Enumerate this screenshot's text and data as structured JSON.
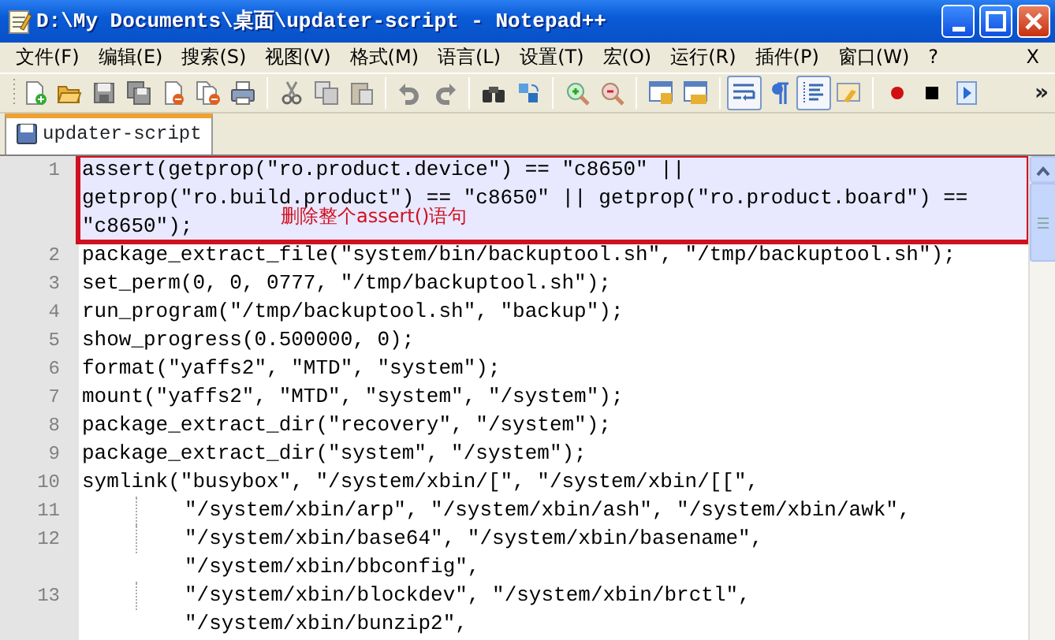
{
  "window": {
    "title": "D:\\My Documents\\桌面\\updater-script - Notepad++"
  },
  "menu": [
    "文件(F)",
    "编辑(E)",
    "搜索(S)",
    "视图(V)",
    "格式(M)",
    "语言(L)",
    "设置(T)",
    "宏(O)",
    "运行(R)",
    "插件(P)",
    "窗口(W)",
    "?"
  ],
  "menu_close": "X",
  "toolbar": [
    {
      "kind": "button",
      "pressed": false
    },
    {
      "kind": "button",
      "pressed": false
    },
    {
      "kind": "button",
      "pressed": false
    },
    {
      "kind": "button",
      "pressed": false
    },
    {
      "kind": "button",
      "pressed": false
    },
    {
      "kind": "button",
      "pressed": false
    },
    {
      "kind": "button",
      "pressed": false
    },
    {
      "kind": "separator"
    },
    {
      "kind": "button",
      "pressed": false
    },
    {
      "kind": "button",
      "pressed": false
    },
    {
      "kind": "button",
      "pressed": false
    },
    {
      "kind": "separator"
    },
    {
      "kind": "button",
      "pressed": false
    },
    {
      "kind": "button",
      "pressed": false
    },
    {
      "kind": "separator"
    },
    {
      "kind": "button",
      "pressed": false
    },
    {
      "kind": "button",
      "pressed": false
    },
    {
      "kind": "separator"
    },
    {
      "kind": "button",
      "pressed": false
    },
    {
      "kind": "button",
      "pressed": false
    },
    {
      "kind": "separator"
    },
    {
      "kind": "button",
      "pressed": false
    },
    {
      "kind": "button",
      "pressed": false
    },
    {
      "kind": "separator"
    },
    {
      "kind": "button",
      "pressed": true
    },
    {
      "kind": "button",
      "pressed": false
    },
    {
      "kind": "button",
      "pressed": true
    },
    {
      "kind": "button",
      "pressed": false
    },
    {
      "kind": "separator"
    },
    {
      "kind": "button",
      "pressed": false
    },
    {
      "kind": "button",
      "pressed": false
    },
    {
      "kind": "button",
      "pressed": false
    }
  ],
  "toolbar_overflow": "»",
  "tabs": [
    {
      "label": "updater-script",
      "selected": true
    }
  ],
  "editor": {
    "lines": [
      {
        "number": "1",
        "current": true,
        "indent": false,
        "annotation": "删除整个assert()语句",
        "rows": [
          "assert(getprop(\"ro.product.device\") == \"c8650\" ||",
          "getprop(\"ro.build.product\") == \"c8650\" || getprop(\"ro.product.board\") ==",
          "\"c8650\");"
        ]
      },
      {
        "number": "2",
        "current": false,
        "indent": false,
        "rows": [
          "package_extract_file(\"system/bin/backuptool.sh\", \"/tmp/backuptool.sh\");"
        ]
      },
      {
        "number": "3",
        "current": false,
        "indent": false,
        "rows": [
          "set_perm(0, 0, 0777, \"/tmp/backuptool.sh\");"
        ]
      },
      {
        "number": "4",
        "current": false,
        "indent": false,
        "rows": [
          "run_program(\"/tmp/backuptool.sh\", \"backup\");"
        ]
      },
      {
        "number": "5",
        "current": false,
        "indent": false,
        "rows": [
          "show_progress(0.500000, 0);"
        ]
      },
      {
        "number": "6",
        "current": false,
        "indent": false,
        "rows": [
          "format(\"yaffs2\", \"MTD\", \"system\");"
        ]
      },
      {
        "number": "7",
        "current": false,
        "indent": false,
        "rows": [
          "mount(\"yaffs2\", \"MTD\", \"system\", \"/system\");"
        ]
      },
      {
        "number": "8",
        "current": false,
        "indent": false,
        "rows": [
          "package_extract_dir(\"recovery\", \"/system\");"
        ]
      },
      {
        "number": "9",
        "current": false,
        "indent": false,
        "rows": [
          "package_extract_dir(\"system\", \"/system\");"
        ]
      },
      {
        "number": "10",
        "current": false,
        "indent": false,
        "rows": [
          "symlink(\"busybox\", \"/system/xbin/[\", \"/system/xbin/[[\","
        ]
      },
      {
        "number": "11",
        "current": false,
        "indent": true,
        "rows": [
          "\"/system/xbin/arp\", \"/system/xbin/ash\", \"/system/xbin/awk\","
        ]
      },
      {
        "number": "12",
        "current": false,
        "indent": true,
        "rows": [
          "\"/system/xbin/base64\", \"/system/xbin/basename\",",
          "\"/system/xbin/bbconfig\","
        ]
      },
      {
        "number": "13",
        "current": false,
        "indent": true,
        "rows": [
          "\"/system/xbin/blockdev\", \"/system/xbin/brctl\",",
          "\"/system/xbin/bunzip2\","
        ]
      }
    ]
  }
}
